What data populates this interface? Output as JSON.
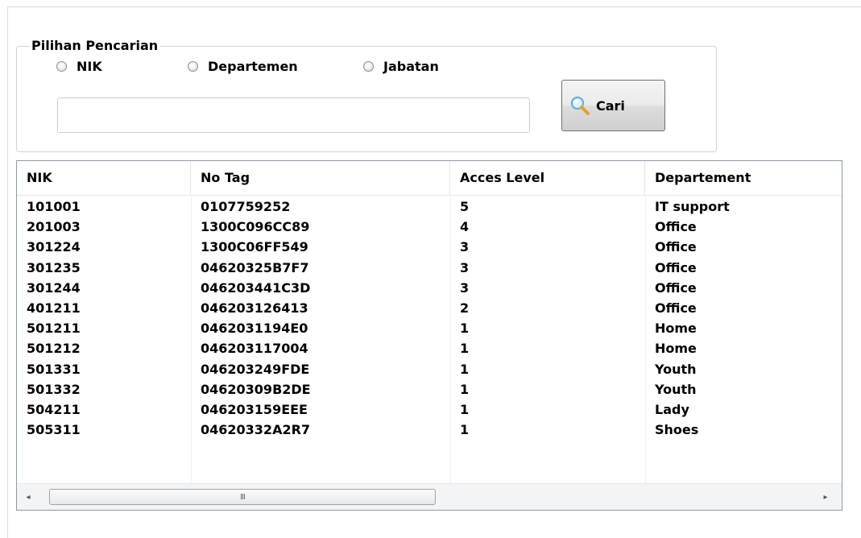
{
  "search": {
    "group_label": "Pilihan Pencarian",
    "options": [
      {
        "label": "NIK"
      },
      {
        "label": "Departemen"
      },
      {
        "label": "Jabatan"
      }
    ],
    "input_value": "",
    "button_label": "Cari",
    "button_icon": "magnifier-icon"
  },
  "table": {
    "columns": [
      "NIK",
      "No Tag",
      "Acces Level",
      "Departement"
    ],
    "rows": [
      [
        "101001",
        "0107759252",
        "5",
        "IT support"
      ],
      [
        "201003",
        "1300C096CC89",
        "4",
        "Office"
      ],
      [
        "301224",
        "1300C06FF549",
        "3",
        "Office"
      ],
      [
        "301235",
        "04620325B7F7",
        "3",
        "Office"
      ],
      [
        "301244",
        "046203441C3D",
        "3",
        "Office"
      ],
      [
        "401211",
        "046203126413",
        "2",
        "Office"
      ],
      [
        "501211",
        "0462031194E0",
        "1",
        "Home"
      ],
      [
        "501212",
        "046203117004",
        "1",
        "Home"
      ],
      [
        "501331",
        "046203249FDE",
        "1",
        "Youth"
      ],
      [
        "501332",
        "04620309B2DE",
        "1",
        "Youth"
      ],
      [
        "504211",
        "046203159EEE",
        "1",
        "Lady"
      ],
      [
        "505311",
        "04620332A2R7",
        "1",
        "Shoes"
      ]
    ]
  },
  "scrollbar": {
    "left_arrow": "◂",
    "right_arrow": "▸",
    "thumb_grip": "III"
  }
}
